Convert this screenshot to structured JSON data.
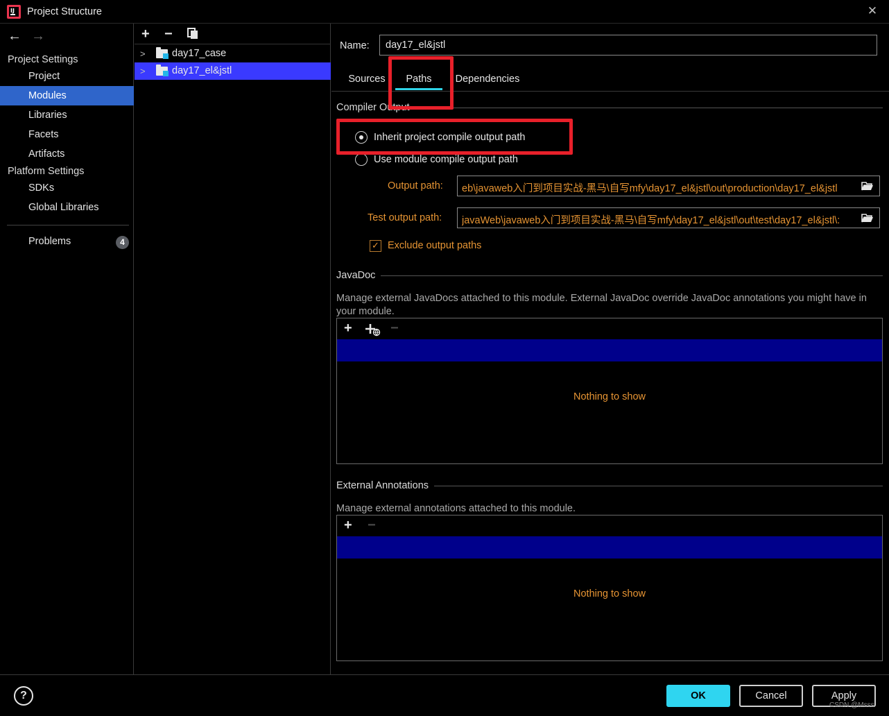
{
  "window": {
    "title": "Project Structure",
    "close_glyph": "✕",
    "app_icon": "intellij-idea-icon"
  },
  "nav": {
    "back_glyph": "←",
    "forward_glyph": "→",
    "project_settings_header": "Project Settings",
    "project_settings_items": [
      "Project",
      "Modules",
      "Libraries",
      "Facets",
      "Artifacts"
    ],
    "platform_settings_header": "Platform Settings",
    "platform_settings_items": [
      "SDKs",
      "Global Libraries"
    ],
    "problems_label": "Problems",
    "problems_count": "4",
    "selected": "Modules"
  },
  "tree": {
    "add_glyph": "+",
    "remove_glyph": "−",
    "modules": [
      {
        "label": "day17_case",
        "selected": false
      },
      {
        "label": "day17_el&jstl",
        "selected": true
      }
    ]
  },
  "module": {
    "name_label": "Name:",
    "name_value": "day17_el&jstl",
    "tabs": [
      "Sources",
      "Paths",
      "Dependencies"
    ],
    "active_tab": "Paths",
    "compiler_output": {
      "title": "Compiler Output",
      "inherit_label": "Inherit project compile output path",
      "use_module_label": "Use module compile output path",
      "selected_option": "inherit",
      "output_path_label": "Output path:",
      "output_path_value": "eb\\javaweb入门到项目实战-黑马\\自写mfy\\day17_el&jstl\\out\\production\\day17_el&jstl",
      "test_output_path_label": "Test output path:",
      "test_output_path_value": ":\\javaWeb\\javaweb入门到项目实战-黑马\\自写mfy\\day17_el&jstl\\out\\test\\day17_el&jstl",
      "exclude_label": "Exclude output paths",
      "exclude_checked": true
    },
    "javadoc": {
      "title": "JavaDoc",
      "description": "Manage external JavaDocs attached to this module. External JavaDoc override JavaDoc annotations you might have in your module.",
      "empty_text": "Nothing to show"
    },
    "annotations": {
      "title": "External Annotations",
      "description": "Manage external annotations attached to this module.",
      "empty_text": "Nothing to show"
    }
  },
  "buttons": {
    "help": "?",
    "ok": "OK",
    "cancel": "Cancel",
    "apply": "Apply"
  },
  "watermark": "CSDN @Msss",
  "colors": {
    "selection": "#2f65ca",
    "tree_selection": "#3a3aff",
    "accent": "#2fd5f0",
    "orange_text": "#e69433",
    "highlight_box": "#e8202a",
    "list_selection": "#00008b"
  }
}
